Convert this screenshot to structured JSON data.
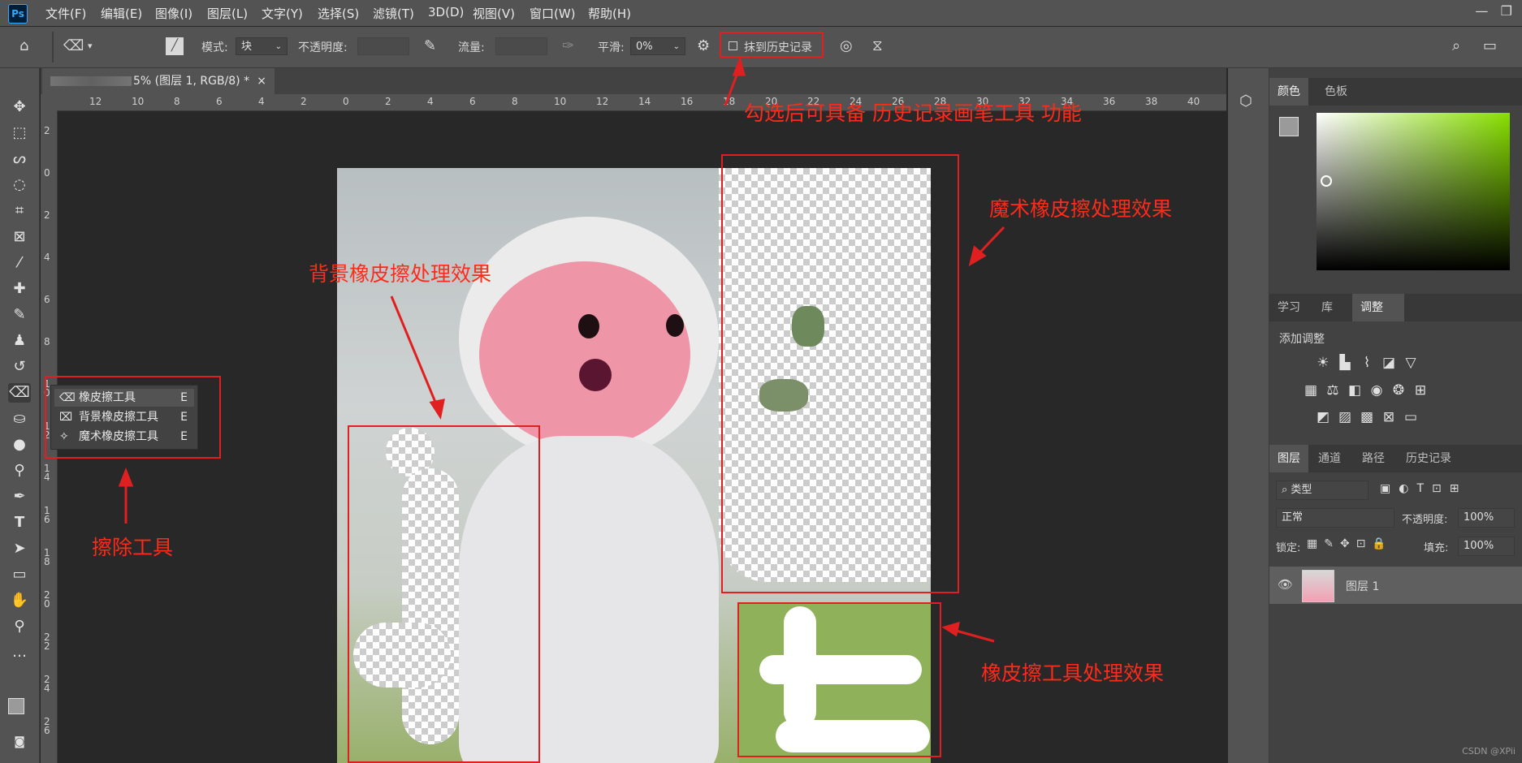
{
  "app": {
    "logo": "Ps"
  },
  "menu": [
    "文件(F)",
    "编辑(E)",
    "图像(I)",
    "图层(L)",
    "文字(Y)",
    "选择(S)",
    "滤镜(T)",
    "3D(D)",
    "视图(V)",
    "窗口(W)",
    "帮助(H)"
  ],
  "options": {
    "mode_label": "模式:",
    "mode_value": "块",
    "opacity_label": "不透明度:",
    "flow_label": "流量:",
    "smooth_label": "平滑:",
    "smooth_value": "0%",
    "erase_history_label": "抹到历史记录"
  },
  "document": {
    "tab_title": "5% (图层 1, RGB/8) *"
  },
  "ruler": {
    "h_ticks": [
      "12",
      "10",
      "8",
      "6",
      "4",
      "2",
      "0",
      "2",
      "4",
      "6",
      "8",
      "10",
      "12",
      "14",
      "16",
      "18",
      "20",
      "22",
      "24",
      "26",
      "28",
      "30",
      "32",
      "34",
      "36",
      "38",
      "40"
    ],
    "v_ticks": [
      "2",
      "0",
      "2",
      "4",
      "6",
      "8",
      "1 0",
      "1 2",
      "1 4",
      "1 6",
      "1 8",
      "2 0",
      "2 2",
      "2 4",
      "2 6"
    ]
  },
  "eraser_flyout": [
    {
      "label": "橡皮擦工具",
      "key": "E"
    },
    {
      "label": "背景橡皮擦工具",
      "key": "E"
    },
    {
      "label": "魔术橡皮擦工具",
      "key": "E"
    }
  ],
  "annotations": {
    "history_note": "勾选后可具备 历史记录画笔工具 功能",
    "magic_note": "魔术橡皮擦处理效果",
    "background_note": "背景橡皮擦处理效果",
    "eraser_tool_note": "擦除工具",
    "eraser_effect_note": "橡皮擦工具处理效果"
  },
  "panels": {
    "color_tabs": [
      "颜色",
      "色板"
    ],
    "adjust_tabs": [
      "学习",
      "库",
      "调整"
    ],
    "adjust_title": "添加调整",
    "layer_tabs": [
      "图层",
      "通道",
      "路径",
      "历史记录"
    ],
    "filter_kind": "类型",
    "blend_mode": "正常",
    "opacity_label": "不透明度:",
    "opacity_value": "100%",
    "lock_label": "锁定:",
    "fill_label": "填充:",
    "fill_value": "100%",
    "layer_name": "图层 1"
  },
  "watermark": "CSDN @XPii",
  "colors": {
    "annotation_red": "#e02020",
    "panel_bg": "#535353",
    "canvas_bg": "#282828"
  }
}
